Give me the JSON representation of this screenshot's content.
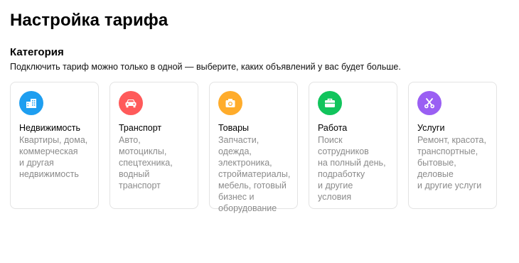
{
  "page": {
    "title": "Настройка тарифа"
  },
  "section": {
    "title": "Категория",
    "subtitle": "Подключить тариф можно только в одной — выберите, каких объявлений у вас будет больше."
  },
  "categories": [
    {
      "name": "Недвижимость",
      "description": "Квартиры, дома,\nкоммерческая\nи другая\nнедвижимость",
      "icon": "building-icon",
      "color": "#1e9ef0"
    },
    {
      "name": "Транспорт",
      "description": "Авто, мотоциклы,\nспецтехника,\nводный транспорт",
      "icon": "car-icon",
      "color": "#ff5a5a"
    },
    {
      "name": "Товары",
      "description": "Запчасти, одежда,\nэлектроника,\nстройматериалы,\nмебель, готовый\nбизнес и\nоборудование",
      "icon": "camera-icon",
      "color": "#ffac2b"
    },
    {
      "name": "Работа",
      "description": "Поиск сотрудников\nна полный день,\nподработку\nи другие условия",
      "icon": "briefcase-icon",
      "color": "#11c45c"
    },
    {
      "name": "Услуги",
      "description": "Ремонт, красота,\nтранспортные,\nбытовые, деловые\nи другие услуги",
      "icon": "scissors-icon",
      "color": "#9a5ff3"
    }
  ]
}
